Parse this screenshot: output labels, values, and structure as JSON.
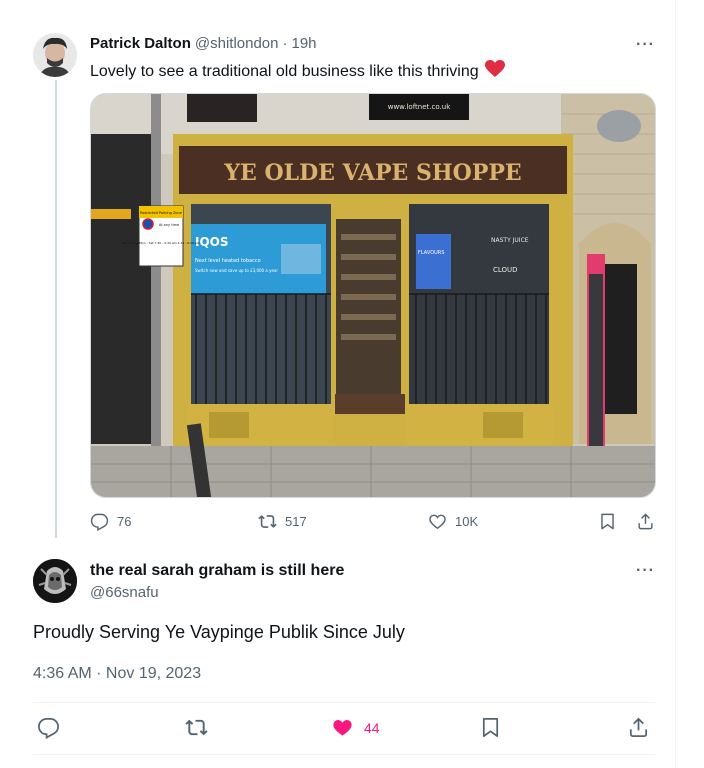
{
  "parent_tweet": {
    "author_name": "Patrick Dalton",
    "author_handle": "@shitlondon",
    "separator": "·",
    "time_ago": "19h",
    "text": "Lovely to see a traditional old business like this thriving",
    "emoji": "heart-emoji",
    "photo": {
      "shop_sign": "YE OLDE VAPE SHOPPE",
      "url_sign": "www.loftnet.co.uk",
      "window_ad_brand": "IQOS",
      "window_ad_line1": "Next level heated tobacco",
      "window_ad_line2": "Switch now and save up to £3,000 a year",
      "parking_sign_title": "Restricted Parking Zone",
      "parking_sign_sub": "At any time",
      "parking_sign_hours": "No loading Mon - Sat 7.30 - 9.30 am 4.30 - 6.30 pm",
      "poster_text": "FLAVOURS",
      "poster_text_2": "CLOUD",
      "poster_text_3": "NASTY JUICE"
    },
    "actions": {
      "replies": "76",
      "retweets": "517",
      "likes": "10K"
    }
  },
  "main_tweet": {
    "author_name": "the real sarah graham is still here",
    "author_handle": "@66snafu",
    "text": "Proudly Serving Ye Vaypinge Publik Since July",
    "timestamp": "4:36 AM · Nov 19, 2023",
    "actions": {
      "likes": "44"
    }
  },
  "more_glyph": "···",
  "colors": {
    "text_primary": "#0f1419",
    "text_secondary": "#536471",
    "like_pink": "#f91880",
    "divider": "#eff3f4"
  }
}
